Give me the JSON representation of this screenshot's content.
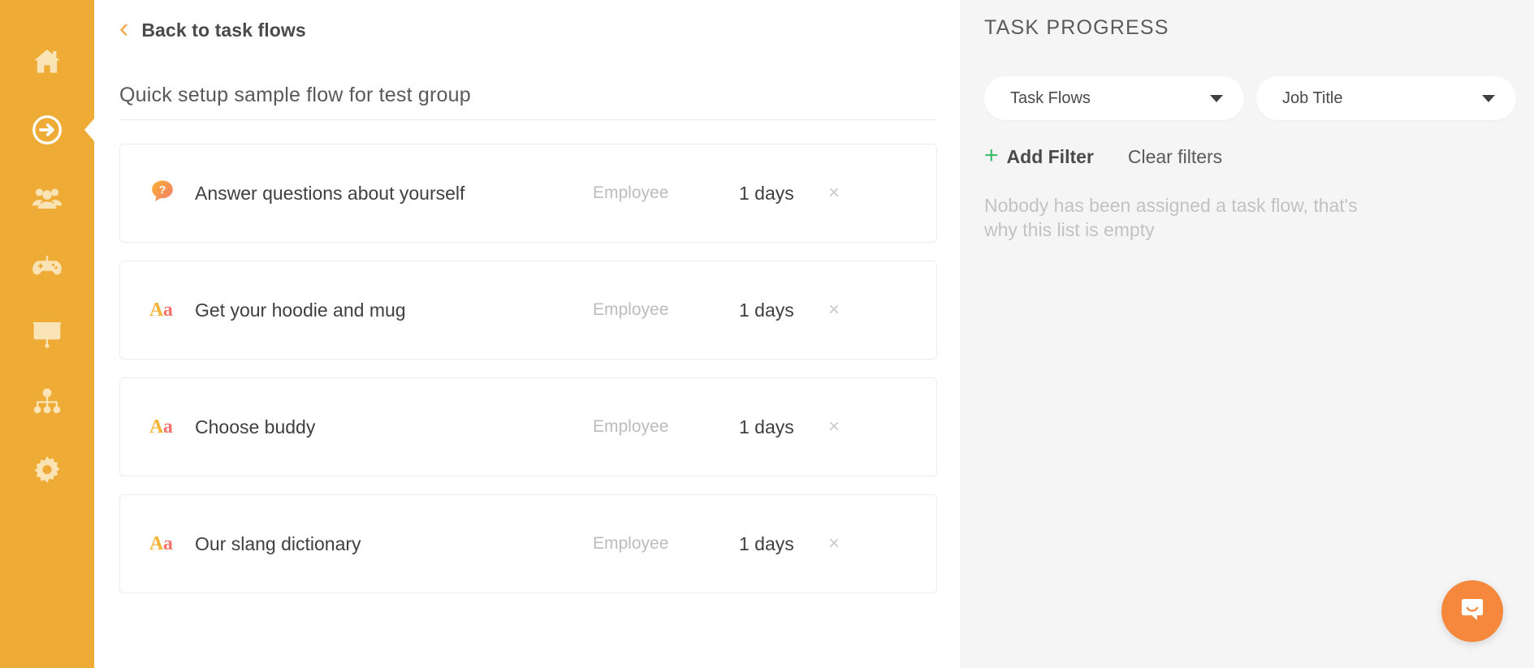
{
  "sidebar": {
    "items": [
      {
        "name": "home",
        "icon": "home-icon",
        "active": false
      },
      {
        "name": "task-flows",
        "icon": "arrow-circle-right-icon",
        "active": true
      },
      {
        "name": "people",
        "icon": "people-group-icon",
        "active": false
      },
      {
        "name": "games",
        "icon": "gamepad-icon",
        "active": false
      },
      {
        "name": "presentations",
        "icon": "presentation-chart-icon",
        "active": false
      },
      {
        "name": "org-chart",
        "icon": "org-chart-icon",
        "active": false
      },
      {
        "name": "settings",
        "icon": "gear-icon",
        "active": false
      }
    ]
  },
  "main": {
    "back_label": "Back to task flows",
    "back_icon": "chevron-left-icon",
    "flow_title": "Quick setup sample flow for test group",
    "tasks": [
      {
        "icon": "question-bubble-icon",
        "icon_type": "question",
        "name": "Answer questions about yourself",
        "role": "Employee",
        "days": "1 days",
        "remove": "×"
      },
      {
        "icon": "text-aa-icon",
        "icon_type": "aa",
        "name": "Get your hoodie and mug",
        "role": "Employee",
        "days": "1 days",
        "remove": "×"
      },
      {
        "icon": "text-aa-icon",
        "icon_type": "aa",
        "name": "Choose buddy",
        "role": "Employee",
        "days": "1 days",
        "remove": "×"
      },
      {
        "icon": "text-aa-icon",
        "icon_type": "aa",
        "name": "Our slang dictionary",
        "role": "Employee",
        "days": "1 days",
        "remove": "×"
      }
    ],
    "aa_upper": "A",
    "aa_lower": "a"
  },
  "right_panel": {
    "title": "TASK PROGRESS",
    "filters": [
      {
        "label": "Task Flows",
        "icon": "chevron-down-icon"
      },
      {
        "label": "Job Title",
        "icon": "chevron-down-icon"
      }
    ],
    "add_filter_label": "Add Filter",
    "add_filter_icon": "plus-icon",
    "clear_filters_label": "Clear filters",
    "empty_state": "Nobody has been assigned a task flow, that's why this list is empty"
  },
  "intercom": {
    "icon": "chat-bubble-smile-icon"
  },
  "colors": {
    "sidebar": "#eeac36",
    "sidebar_icon": "#fae3b4",
    "accent_orange": "#f0a848",
    "panel_bg": "#f5f5f5",
    "plus_green": "#3fbb6d",
    "intercom_orange": "#f5883c",
    "aa_upper": "#f5b335",
    "aa_lower": "#f5736a"
  }
}
